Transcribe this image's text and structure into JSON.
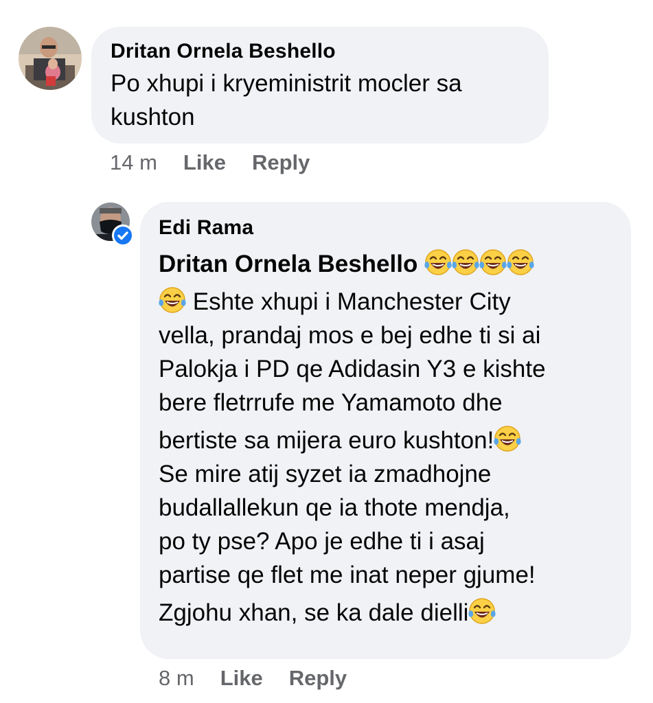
{
  "comment": {
    "author": "Dritan Ornela Beshello",
    "text_lines": [
      "Po xhupi i kryeministrit mocler sa",
      "kushton"
    ],
    "time": "14 m",
    "like_label": "Like",
    "reply_label": "Reply"
  },
  "reply": {
    "author": "Edi Rama",
    "mention": "Dritan Ornela Beshello",
    "lines": [
      "Eshte xhupi i Manchester City",
      "vella, prandaj mos e bej edhe ti si ai",
      "Palokja i PD qe Adidasin Y3 e kishte",
      "bere fletrrufe me Yamamoto dhe",
      "bertiste sa mijera euro kushton!",
      "Se mire atij syzet ia zmadhojne",
      "budallallekun qe ia thote mendja,",
      "po ty pse? Apo je edhe ti i asaj",
      "partise qe flet me inat neper gjume!",
      "Zgjohu xhan, se ka dale dielli"
    ],
    "time": "8 m",
    "like_label": "Like",
    "reply_label": "Reply"
  },
  "icons": {
    "emoji": "face-with-tears-of-joy-icon",
    "verified": "verified-badge-icon"
  },
  "colors": {
    "bubble": "#f0f2f5",
    "meta_text": "#65676b",
    "verified": "#1877f2"
  }
}
